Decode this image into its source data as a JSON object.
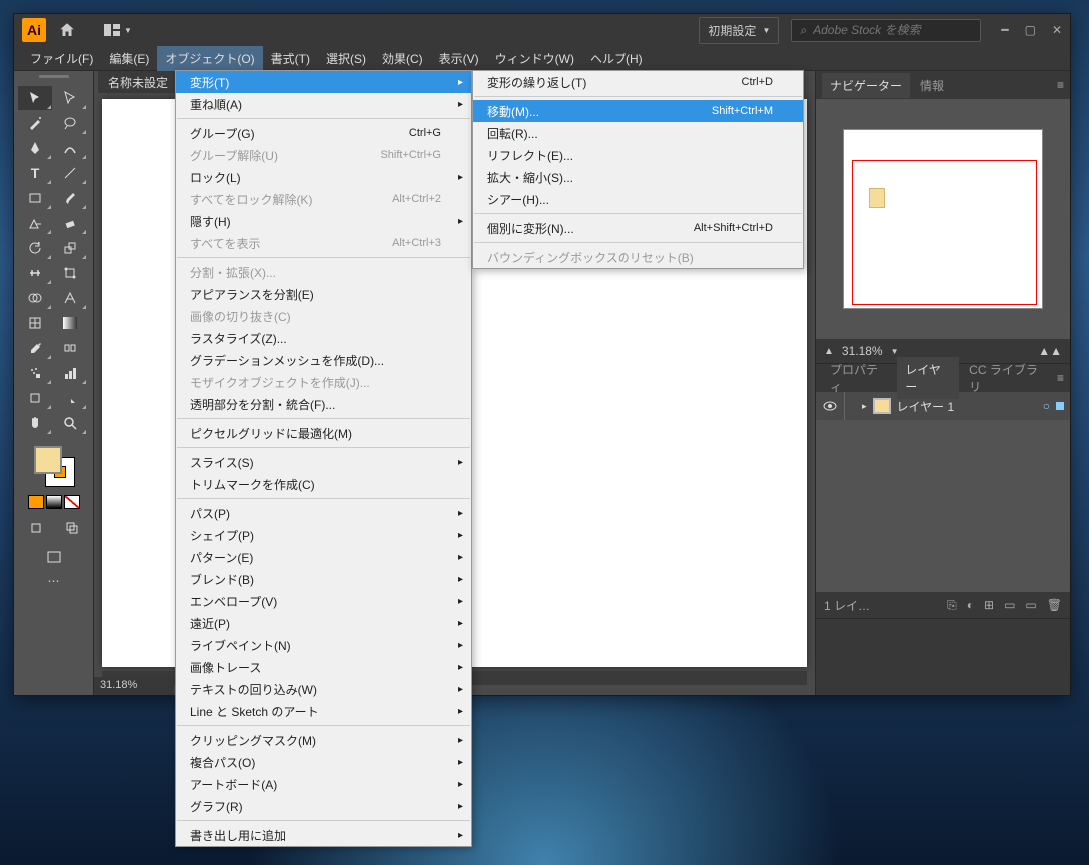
{
  "app_logo": "Ai",
  "workspace_label": "初期設定",
  "search_placeholder": "Adobe Stock を検索",
  "menubar": [
    "ファイル(F)",
    "編集(E)",
    "オブジェクト(O)",
    "書式(T)",
    "選択(S)",
    "効果(C)",
    "表示(V)",
    "ウィンドウ(W)",
    "ヘルプ(H)"
  ],
  "doc_tab": "名称未設定",
  "status_zoom": "31.18%",
  "nav": {
    "tabs": [
      "ナビゲーター",
      "情報"
    ],
    "zoom": "31.18%"
  },
  "layers": {
    "tabs": [
      "プロパティ",
      "レイヤー",
      "CC ライブラリ"
    ],
    "row": "レイヤー 1",
    "footer": "1 レイ…"
  },
  "primary_menu": [
    {
      "label": "変形(T)",
      "sub": true,
      "hl": true
    },
    {
      "label": "重ね順(A)",
      "sub": true
    },
    {
      "sep": true
    },
    {
      "label": "グループ(G)",
      "shortcut": "Ctrl+G"
    },
    {
      "label": "グループ解除(U)",
      "shortcut": "Shift+Ctrl+G",
      "disabled": true
    },
    {
      "label": "ロック(L)",
      "sub": true
    },
    {
      "label": "すべてをロック解除(K)",
      "shortcut": "Alt+Ctrl+2",
      "disabled": true
    },
    {
      "label": "隠す(H)",
      "sub": true
    },
    {
      "label": "すべてを表示",
      "shortcut": "Alt+Ctrl+3",
      "disabled": true
    },
    {
      "sep": true
    },
    {
      "label": "分割・拡張(X)...",
      "disabled": true
    },
    {
      "label": "アピアランスを分割(E)"
    },
    {
      "label": "画像の切り抜き(C)",
      "disabled": true
    },
    {
      "label": "ラスタライズ(Z)..."
    },
    {
      "label": "グラデーションメッシュを作成(D)..."
    },
    {
      "label": "モザイクオブジェクトを作成(J)...",
      "disabled": true
    },
    {
      "label": "透明部分を分割・統合(F)..."
    },
    {
      "sep": true
    },
    {
      "label": "ピクセルグリッドに最適化(M)"
    },
    {
      "sep": true
    },
    {
      "label": "スライス(S)",
      "sub": true
    },
    {
      "label": "トリムマークを作成(C)"
    },
    {
      "sep": true
    },
    {
      "label": "パス(P)",
      "sub": true
    },
    {
      "label": "シェイプ(P)",
      "sub": true
    },
    {
      "label": "パターン(E)",
      "sub": true
    },
    {
      "label": "ブレンド(B)",
      "sub": true
    },
    {
      "label": "エンベロープ(V)",
      "sub": true
    },
    {
      "label": "遠近(P)",
      "sub": true
    },
    {
      "label": "ライブペイント(N)",
      "sub": true
    },
    {
      "label": "画像トレース",
      "sub": true
    },
    {
      "label": "テキストの回り込み(W)",
      "sub": true
    },
    {
      "label": "Line と Sketch のアート",
      "sub": true
    },
    {
      "sep": true
    },
    {
      "label": "クリッピングマスク(M)",
      "sub": true
    },
    {
      "label": "複合パス(O)",
      "sub": true
    },
    {
      "label": "アートボード(A)",
      "sub": true
    },
    {
      "label": "グラフ(R)",
      "sub": true
    },
    {
      "sep": true
    },
    {
      "label": "書き出し用に追加",
      "sub": true
    }
  ],
  "sub_menu": [
    {
      "label": "変形の繰り返し(T)",
      "shortcut": "Ctrl+D"
    },
    {
      "sep": true
    },
    {
      "label": "移動(M)...",
      "shortcut": "Shift+Ctrl+M",
      "hl": true
    },
    {
      "label": "回転(R)..."
    },
    {
      "label": "リフレクト(E)..."
    },
    {
      "label": "拡大・縮小(S)..."
    },
    {
      "label": "シアー(H)..."
    },
    {
      "sep": true
    },
    {
      "label": "個別に変形(N)...",
      "shortcut": "Alt+Shift+Ctrl+D"
    },
    {
      "sep": true
    },
    {
      "label": "バウンディングボックスのリセット(B)",
      "disabled": true
    }
  ]
}
